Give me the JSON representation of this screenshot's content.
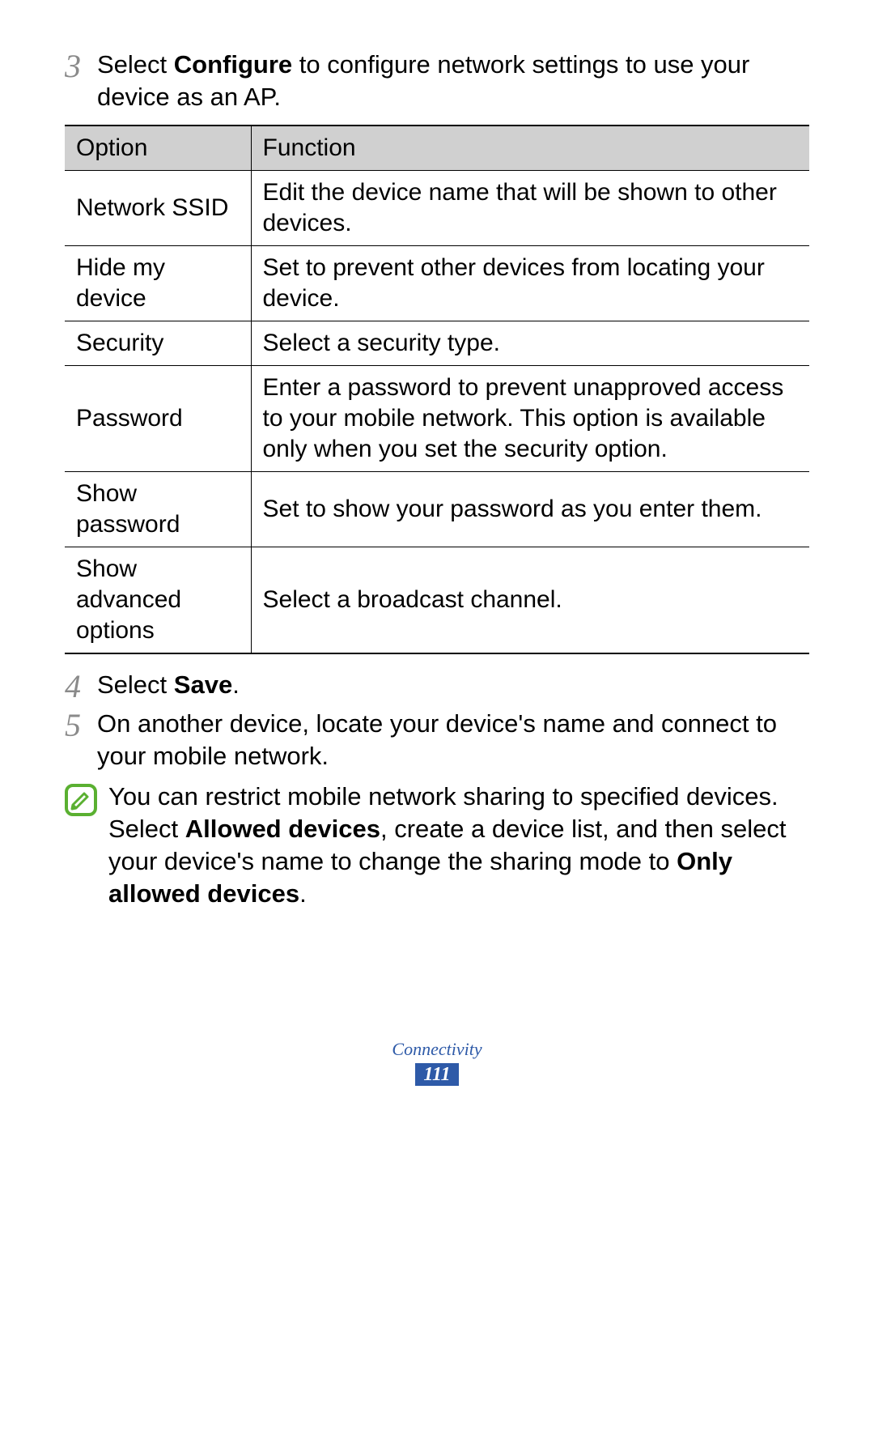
{
  "steps": {
    "s3": {
      "num": "3",
      "pre": "Select ",
      "bold": "Configure",
      "post": " to configure network settings to use your device as an AP."
    },
    "s4": {
      "num": "4",
      "pre": "Select ",
      "bold": "Save",
      "post": "."
    },
    "s5": {
      "num": "5",
      "text": "On another device, locate your device's name and connect to your mobile network."
    }
  },
  "table": {
    "header": {
      "option": "Option",
      "function": "Function"
    },
    "rows": [
      {
        "option": "Network SSID",
        "function": "Edit the device name that will be shown to other devices."
      },
      {
        "option": "Hide my device",
        "function": "Set to prevent other devices from locating your device."
      },
      {
        "option": "Security",
        "function": "Select a security type."
      },
      {
        "option": "Password",
        "function": "Enter a password to prevent unapproved access to your mobile network. This option is available only when you set the security option."
      },
      {
        "option": "Show password",
        "function": "Set to show your password as you enter them."
      },
      {
        "option": "Show advanced options",
        "function": "Select a broadcast channel."
      }
    ]
  },
  "note": {
    "p1": "You can restrict mobile network sharing to specified devices. Select ",
    "b1": "Allowed devices",
    "p2": ", create a device list, and then select your device's name to change the sharing mode to ",
    "b2": "Only allowed devices",
    "p3": "."
  },
  "footer": {
    "section": "Connectivity",
    "page": "111"
  }
}
